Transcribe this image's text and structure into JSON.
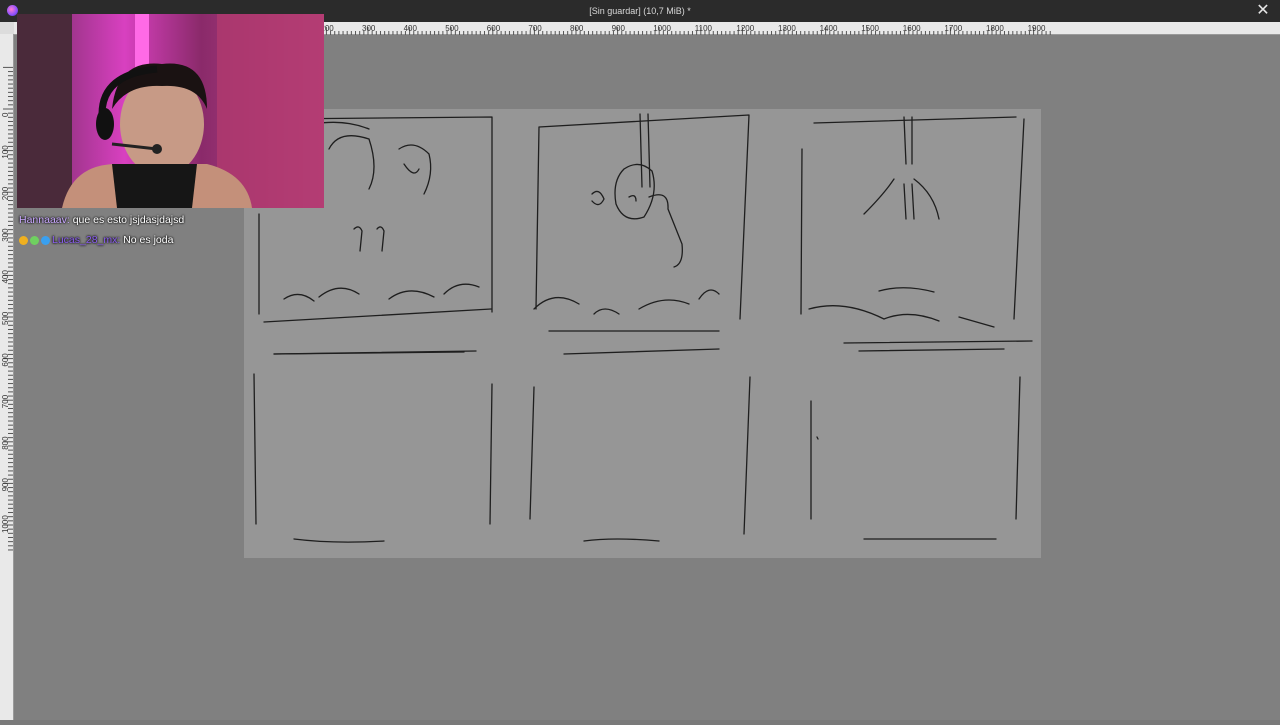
{
  "window": {
    "title": "[Sin guardar]  (10,7 MiB) *",
    "close_glyph": "✕"
  },
  "ruler": {
    "top_labels": [
      "200",
      "300",
      "400",
      "500",
      "600",
      "700",
      "800",
      "900",
      "1000",
      "1100",
      "1200",
      "1300",
      "1400",
      "1500",
      "1600",
      "1700",
      "1800",
      "1900"
    ],
    "left_labels": [
      "0",
      "100",
      "200",
      "300",
      "400",
      "500",
      "600",
      "700",
      "800",
      "900",
      "1000"
    ]
  },
  "chat": {
    "messages": [
      {
        "user": "Hannaaav:",
        "text": "que es esto jsjdasjdajsd"
      },
      {
        "user": "Lucas_28_mx:",
        "text": "No es joda"
      }
    ]
  },
  "colors": {
    "titlebar": "#2b2b2b",
    "workspace": "#808080",
    "canvas": "#969696",
    "ink": "#1e1e1e"
  },
  "icons": [
    "app-icon",
    "close-icon",
    "badge-icons"
  ]
}
